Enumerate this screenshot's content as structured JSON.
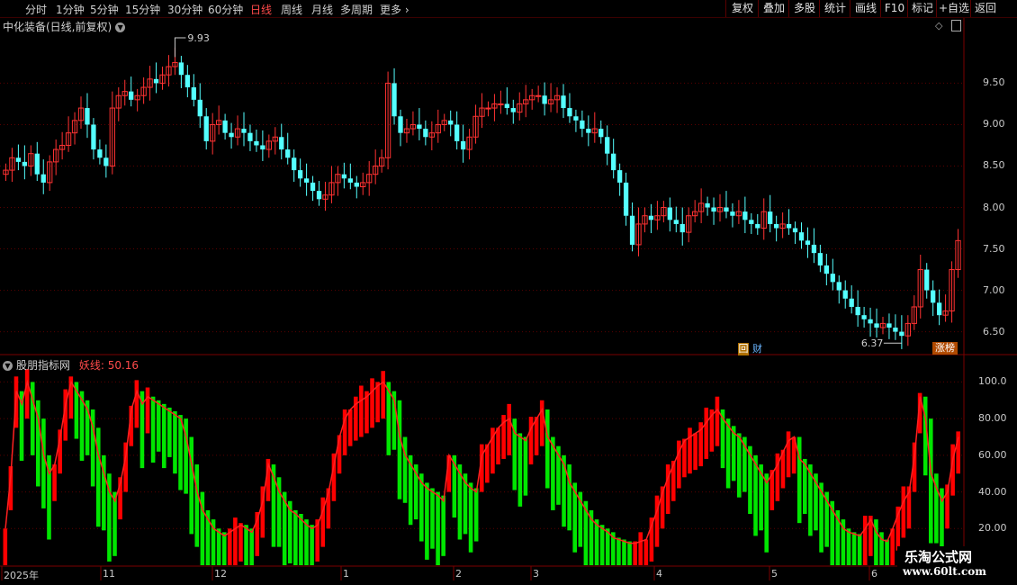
{
  "toolbar": {
    "periods": [
      "分时",
      "1分钟",
      "5分钟",
      "15分钟",
      "30分钟",
      "60分钟",
      "日线",
      "周线",
      "月线",
      "多周期",
      "更多"
    ],
    "active_period": "日线",
    "more_arrow": "›",
    "right_buttons": [
      "复权",
      "叠加",
      "多股",
      "统计",
      "画线",
      "F10",
      "标记",
      "+自选",
      "返回"
    ]
  },
  "main_chart": {
    "title": "中化装备(日线,前复权)",
    "high_marker": "9.93",
    "low_marker": "6.37",
    "y_ticks": [
      "9.50",
      "9.00",
      "8.50",
      "8.00",
      "7.50",
      "7.00",
      "6.50"
    ],
    "badge_hui": "回",
    "badge_cai": "财",
    "badge_zhangbang": "涨榜"
  },
  "indicator": {
    "title": "股朋指标网",
    "value_label": "妖线: 50.16",
    "y_ticks": [
      "100.0",
      "80.00",
      "60.00",
      "40.00",
      "20.00"
    ]
  },
  "x_axis": [
    "2025年",
    "11",
    "12",
    "1",
    "2",
    "3",
    "4",
    "5",
    "6"
  ],
  "brand": {
    "name": "乐淘公式网",
    "url": "www.60lt.com"
  },
  "colors": {
    "up": "#ff3232",
    "down": "#54ffff",
    "bar_up": "#ff0000",
    "bar_down": "#00e600",
    "grid": "#5a0000",
    "active": "#ff4a4a"
  },
  "chart_data": [
    {
      "type": "candlestick",
      "title": "中化装备(日线,前复权)",
      "ylim": [
        6.3,
        10.2
      ],
      "y_ticks": [
        9.5,
        9.0,
        8.5,
        8.0,
        7.5,
        7.0,
        6.5
      ],
      "x_ticks": [
        "2025年",
        "11",
        "12",
        "1",
        "2",
        "3",
        "4",
        "5",
        "6"
      ],
      "annotations": [
        {
          "label": "9.93"
        },
        {
          "label": "6.37"
        }
      ],
      "close": [
        8.45,
        8.6,
        8.55,
        8.5,
        8.65,
        8.4,
        8.3,
        8.55,
        8.7,
        8.75,
        8.9,
        9.05,
        9.2,
        9.0,
        8.7,
        8.6,
        8.5,
        9.2,
        9.35,
        9.4,
        9.3,
        9.35,
        9.45,
        9.55,
        9.5,
        9.6,
        9.7,
        9.75,
        9.6,
        9.45,
        9.3,
        9.1,
        8.8,
        9.0,
        9.05,
        8.9,
        8.85,
        8.95,
        8.9,
        8.8,
        8.75,
        8.7,
        8.8,
        8.85,
        8.7,
        8.6,
        8.45,
        8.35,
        8.3,
        8.2,
        8.1,
        8.15,
        8.3,
        8.4,
        8.35,
        8.3,
        8.25,
        8.3,
        8.4,
        8.5,
        8.6,
        9.5,
        9.1,
        8.9,
        8.95,
        9.0,
        8.95,
        8.85,
        8.9,
        9.0,
        9.05,
        9.0,
        8.8,
        8.7,
        8.85,
        9.1,
        9.2,
        9.2,
        9.25,
        9.25,
        9.2,
        9.15,
        9.25,
        9.3,
        9.35,
        9.35,
        9.25,
        9.3,
        9.35,
        9.2,
        9.1,
        9.05,
        8.95,
        8.9,
        8.95,
        8.85,
        8.65,
        8.45,
        8.3,
        7.9,
        7.55,
        7.8,
        7.9,
        7.85,
        7.9,
        8.0,
        7.85,
        7.8,
        7.7,
        7.9,
        7.95,
        8.05,
        8.0,
        7.95,
        8.0,
        7.95,
        7.9,
        7.95,
        7.85,
        7.8,
        7.75,
        7.95,
        7.8,
        7.75,
        7.8,
        7.75,
        7.7,
        7.6,
        7.55,
        7.45,
        7.3,
        7.2,
        7.1,
        7.0,
        6.9,
        6.8,
        6.7,
        6.65,
        6.6,
        6.55,
        6.6,
        6.55,
        6.5,
        6.45,
        6.6,
        6.8,
        7.25,
        7.0,
        6.85,
        6.7,
        6.75,
        7.25,
        7.6
      ]
    },
    {
      "type": "bar",
      "title": "股朋指标网",
      "series": [
        {
          "name": "妖线",
          "last_value": 50.16
        }
      ],
      "ylim": [
        0,
        112
      ],
      "y_ticks": [
        100,
        80,
        60,
        40,
        20
      ],
      "values": [
        20,
        50,
        95,
        88,
        100,
        90,
        80,
        60,
        50,
        55,
        70,
        88,
        100,
        95,
        90,
        85,
        75,
        60,
        50,
        40,
        35,
        45,
        60,
        85,
        95,
        88,
        92,
        90,
        88,
        86,
        84,
        82,
        80,
        70,
        55,
        40,
        30,
        25,
        20,
        18,
        16,
        18,
        20,
        22,
        20,
        18,
        25,
        35,
        55,
        48,
        40,
        35,
        30,
        28,
        25,
        22,
        20,
        22,
        30,
        40,
        55,
        70,
        80,
        85,
        88,
        90,
        92,
        95,
        98,
        100,
        95,
        90,
        70,
        60,
        55,
        50,
        45,
        42,
        40,
        38,
        35,
        60,
        55,
        50,
        45,
        42,
        40,
        60,
        65,
        70,
        75,
        78,
        80,
        72,
        70,
        68,
        75,
        80,
        85,
        70,
        65,
        60,
        55,
        45,
        40,
        35,
        30,
        25,
        22,
        20,
        18,
        15,
        14,
        13,
        12,
        12,
        13,
        14,
        22,
        30,
        40,
        48,
        55,
        62,
        68,
        70,
        72,
        74,
        78,
        82,
        85,
        80,
        76,
        72,
        70,
        65,
        60,
        55,
        50,
        45,
        50,
        55,
        62,
        68,
        70,
        58,
        55,
        50,
        45,
        40,
        35,
        30,
        25,
        20,
        18,
        17,
        16,
        20,
        25,
        18,
        14,
        13,
        20,
        28,
        35,
        40,
        60,
        92,
        80,
        50,
        42,
        35,
        40,
        58,
        70
      ]
    }
  ]
}
